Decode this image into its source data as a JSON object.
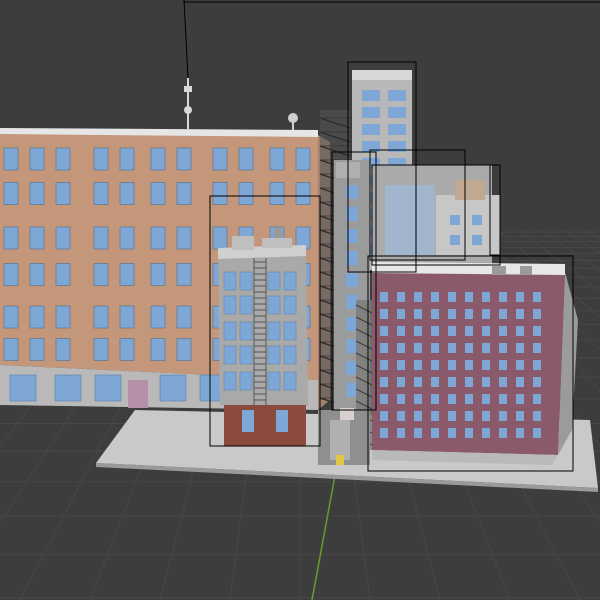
{
  "viewport": {
    "background": "#3d3d3d",
    "grid_color": "#4a4a4a",
    "grid_color_major": "#555555",
    "axis_y_color": "#6a9b2a",
    "selection_outline": "#000000"
  },
  "scene": {
    "ground_color": "#c9c9c9",
    "brick_left_color": "#c4977a",
    "brick_right_color": "#8a5a6a",
    "gray_building_color": "#a9a9a9",
    "window_color": "#7ea7d6",
    "tower_color": "#b8b8b8",
    "ground_floor_brick": "#8b4a3e"
  }
}
